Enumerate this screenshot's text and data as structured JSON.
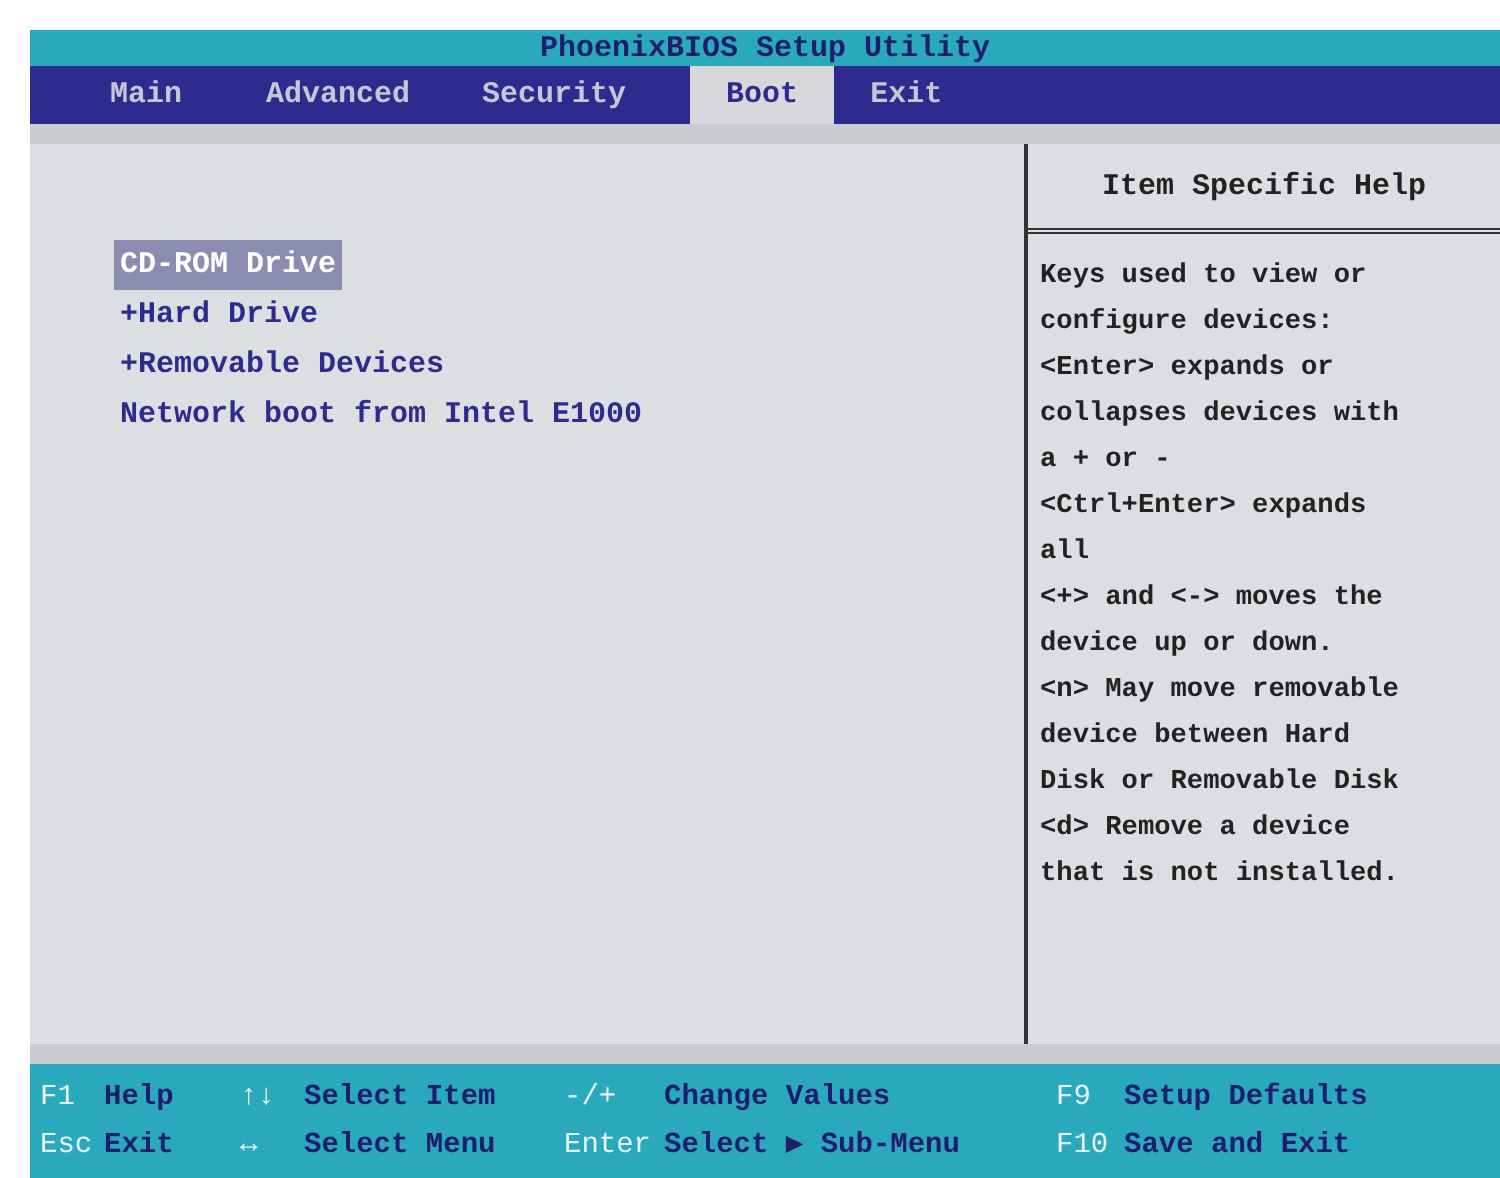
{
  "window": {
    "title": "PhoenixBIOS Setup Utility"
  },
  "tabs": [
    {
      "label": "Main",
      "selected": false
    },
    {
      "label": "Advanced",
      "selected": false
    },
    {
      "label": "Security",
      "selected": false
    },
    {
      "label": "Boot",
      "selected": true
    },
    {
      "label": "Exit",
      "selected": false
    }
  ],
  "boot_items": [
    {
      "label": "CD-ROM Drive",
      "selected": true
    },
    {
      "label": "+Hard Drive",
      "selected": false
    },
    {
      "label": "+Removable Devices",
      "selected": false
    },
    {
      "label": "Network boot from Intel E1000",
      "selected": false
    }
  ],
  "help": {
    "title": "Item Specific Help",
    "lines": [
      "Keys used to view or",
      "configure devices:",
      "<Enter> expands or",
      "collapses devices with",
      "a + or -",
      "<Ctrl+Enter> expands",
      "all",
      "<+> and <-> moves the",
      "device up or down.",
      "<n> May move removable",
      "device between Hard",
      "Disk or Removable Disk",
      "<d> Remove a device",
      "that is not installed."
    ]
  },
  "status_bar": [
    [
      {
        "key": "F1",
        "action": "Help"
      },
      {
        "key": "↑↓",
        "action": "Select Item"
      },
      {
        "key": "-/+",
        "action": "Change Values"
      },
      {
        "key": "F9",
        "action": "Setup Defaults"
      }
    ],
    [
      {
        "key": "Esc",
        "action": "Exit"
      },
      {
        "key": "↔",
        "action": "Select Menu"
      },
      {
        "key": "Enter",
        "action": "Select ▶ Sub-Menu"
      },
      {
        "key": "F10",
        "action": "Save and Exit"
      }
    ]
  ]
}
